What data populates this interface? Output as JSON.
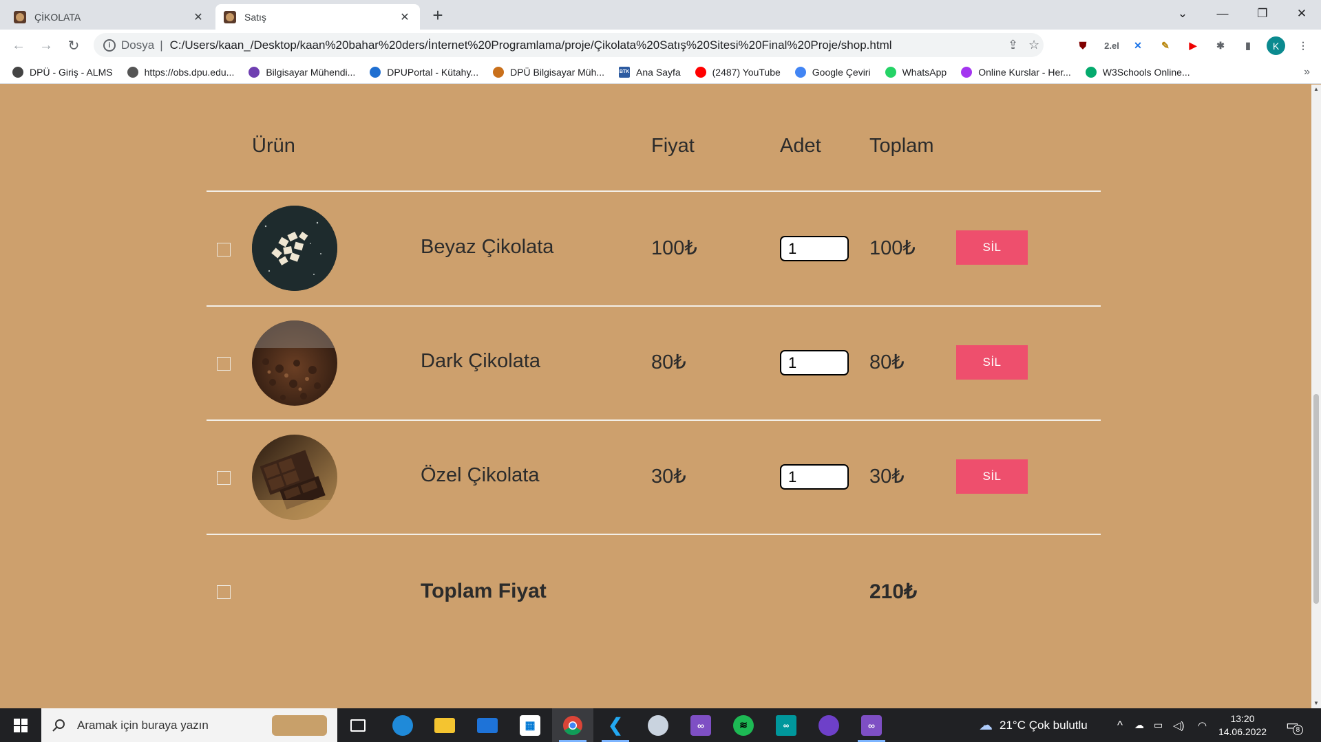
{
  "browser": {
    "tabs": [
      {
        "title": "ÇİKOLATA",
        "active": false
      },
      {
        "title": "Satış",
        "active": true
      }
    ],
    "scheme_label": "Dosya",
    "url": "C:/Users/kaan_/Desktop/kaan%20bahar%20ders/İnternet%20Programlama/proje/Çikolata%20Satış%20Sitesi%20Final%20Proje/shop.html",
    "ext_label": "2.el",
    "profile_initial": "K"
  },
  "bookmarks": [
    {
      "label": "DPÜ - Giriş - ALMS",
      "color": "#444444"
    },
    {
      "label": "https://obs.dpu.edu...",
      "color": "#555555"
    },
    {
      "label": "Bilgisayar Mühendi...",
      "color": "#6f3fb1"
    },
    {
      "label": "DPUPortal - Kütahy...",
      "color": "#1f6fd1"
    },
    {
      "label": "DPÜ Bilgisayar Müh...",
      "color": "#c9701b"
    },
    {
      "label": "Ana Sayfa",
      "color": "#2c5aa0",
      "icon_text": "BTK"
    },
    {
      "label": "(2487) YouTube",
      "color": "#ff0000"
    },
    {
      "label": "Google Çeviri",
      "color": "#4285f4"
    },
    {
      "label": "WhatsApp",
      "color": "#25d366"
    },
    {
      "label": "Online Kurslar - Her...",
      "color": "#a435f0"
    },
    {
      "label": "W3Schools Online...",
      "color": "#04aa6d"
    }
  ],
  "cart": {
    "headers": {
      "product": "Ürün",
      "price": "Fiyat",
      "qty": "Adet",
      "total": "Toplam"
    },
    "items": [
      {
        "name": "Beyaz Çikolata",
        "price": "100₺",
        "qty": "1",
        "total": "100₺",
        "delete_label": "SİL"
      },
      {
        "name": "Dark Çikolata",
        "price": "80₺",
        "qty": "1",
        "total": "80₺",
        "delete_label": "SİL"
      },
      {
        "name": "Özel Çikolata",
        "price": "30₺",
        "qty": "1",
        "total": "30₺",
        "delete_label": "SİL"
      }
    ],
    "total_label": "Toplam Fiyat",
    "total_value": "210₺"
  },
  "taskbar": {
    "search_placeholder": "Aramak için buraya yazın",
    "weather": "21°C  Çok bulutlu",
    "time": "13:20",
    "date": "14.06.2022",
    "notification_count": "8"
  }
}
